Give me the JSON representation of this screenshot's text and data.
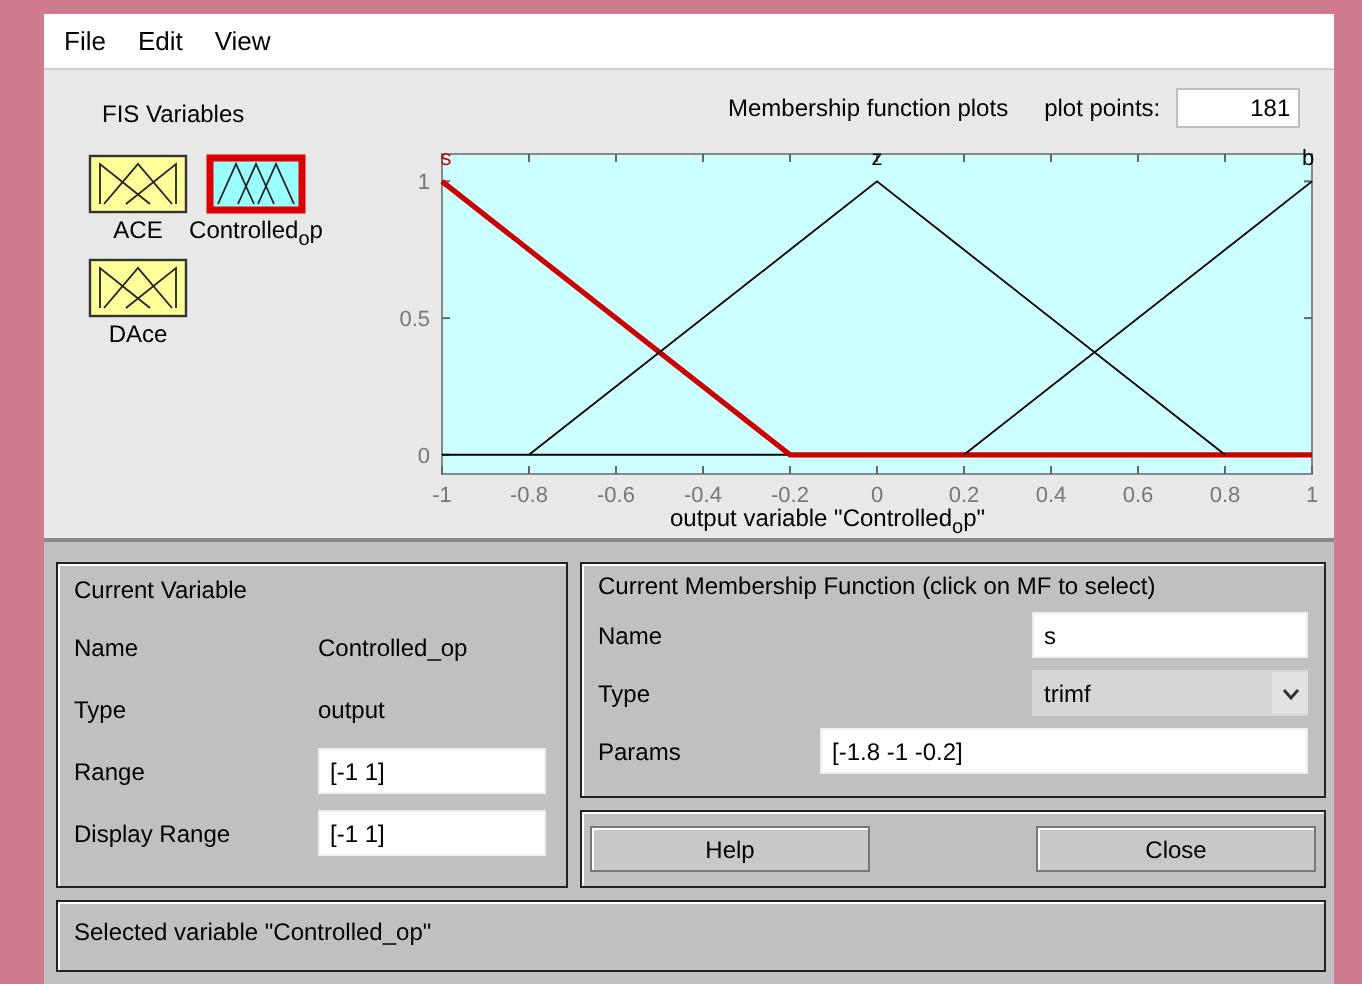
{
  "menu": [
    "File",
    "Edit",
    "View"
  ],
  "fis_variables": {
    "title": "FIS Variables",
    "items": [
      {
        "label": "ACE",
        "kind": "input",
        "selected": false
      },
      {
        "label": "Controlled$_{o}$p",
        "kind": "output",
        "selected": true
      },
      {
        "label": "DAce",
        "kind": "input",
        "selected": false
      }
    ]
  },
  "plot": {
    "title": "Membership function plots",
    "plot_points_label": "plot points:",
    "plot_points": "181",
    "chart_data": {
      "type": "line",
      "xlabel": "output variable \"Controlled$_{o}$p\"",
      "x": [
        -1,
        -0.8,
        -0.2,
        0,
        0.2,
        0.8,
        1
      ],
      "series": [
        {
          "name": "s",
          "color": "#cc0000",
          "values": [
            1,
            0.75,
            0,
            0,
            0,
            0,
            0
          ]
        },
        {
          "name": "z",
          "color": "#000000",
          "values": [
            null,
            0,
            0.75,
            1,
            0.75,
            0,
            null
          ]
        },
        {
          "name": "b",
          "color": "#000000",
          "values": [
            null,
            null,
            null,
            null,
            0,
            0.75,
            1
          ]
        }
      ],
      "xlim": [
        -1,
        1
      ],
      "ylim": [
        -0.07,
        1.1
      ],
      "xticks": [
        -1,
        -0.8,
        -0.6,
        -0.4,
        -0.2,
        0,
        0.2,
        0.4,
        0.6,
        0.8,
        1
      ],
      "yticks": [
        0,
        0.5,
        1
      ]
    }
  },
  "current_variable": {
    "title": "Current Variable",
    "fields": [
      {
        "label": "Name",
        "value": "Controlled_op",
        "kind": "text"
      },
      {
        "label": "Type",
        "value": "output",
        "kind": "text"
      },
      {
        "label": "Range",
        "value": "[-1 1]",
        "kind": "input"
      },
      {
        "label": "Display Range",
        "value": "[-1 1]",
        "kind": "input"
      }
    ]
  },
  "current_mf": {
    "title": "Current Membership Function (click on MF to select)",
    "fields": [
      {
        "label": "Name",
        "value": "s",
        "kind": "input"
      },
      {
        "label": "Type",
        "value": "trimf",
        "kind": "dropdown"
      },
      {
        "label": "Params",
        "value": "[-1.8 -1 -0.2]",
        "kind": "wide_input"
      }
    ]
  },
  "buttons": [
    "Help",
    "Close"
  ],
  "status": "Selected variable \"Controlled_op\""
}
